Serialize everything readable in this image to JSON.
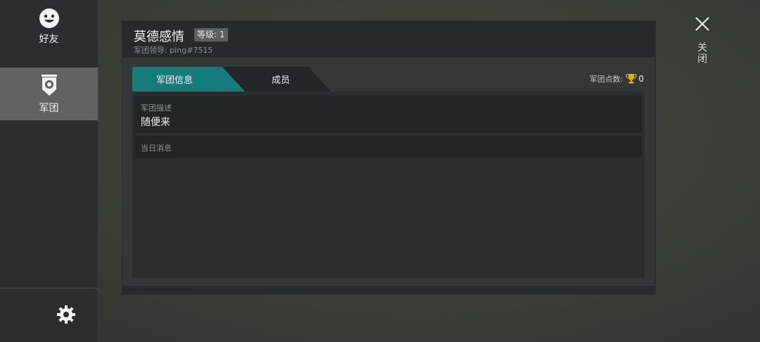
{
  "sidebar": {
    "items": [
      {
        "label": "好友",
        "icon": "smiley-icon"
      },
      {
        "label": "军团",
        "icon": "clan-banner-icon"
      }
    ],
    "settings_icon": "gear-icon"
  },
  "close": {
    "label": "关闭",
    "icon": "close-icon"
  },
  "panel": {
    "clan_name": "莫德感情",
    "level": "等级: 1",
    "leader": "军团领导: ping#7515",
    "tabs": [
      {
        "label": "军团信息",
        "active": true
      },
      {
        "label": "成员",
        "active": false
      }
    ],
    "points_label": "军团点数:",
    "points_value": "0",
    "trophy_icon": "trophy-icon",
    "description_label": "军团描述",
    "description_value": "随便来",
    "daily_label": "当日消息"
  },
  "colors": {
    "accent": "#157b7b",
    "trophy": "#d9b200"
  }
}
